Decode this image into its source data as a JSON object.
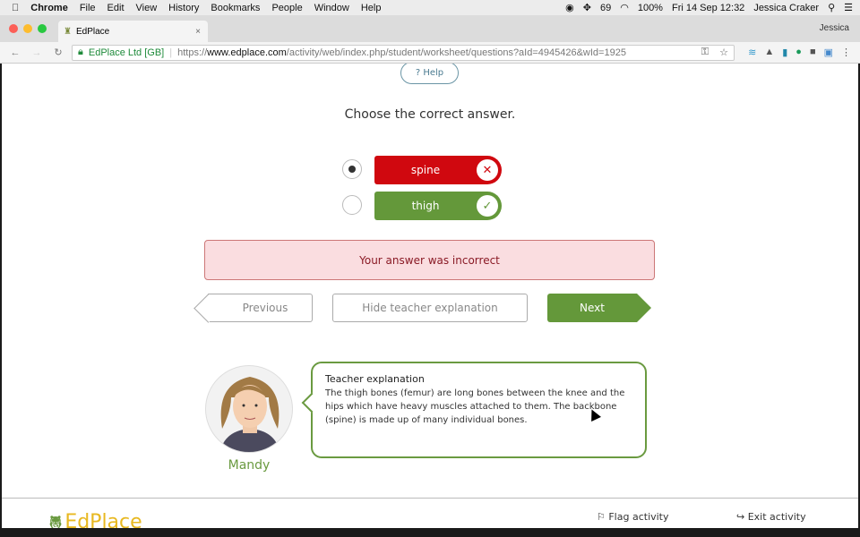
{
  "menubar": {
    "app": "Chrome",
    "items": [
      "File",
      "Edit",
      "View",
      "History",
      "Bookmarks",
      "People",
      "Window",
      "Help"
    ],
    "status": {
      "badge_count": "69",
      "battery": "100%",
      "datetime": "Fri 14 Sep 12:32",
      "user": "Jessica Craker"
    }
  },
  "browser": {
    "tab_title": "EdPlace",
    "profile": "Jessica",
    "security_label": "EdPlace Ltd [GB]",
    "url_prefix": "https://",
    "url_domain": "www.edplace.com",
    "url_path": "/activity/web/index.php/student/worksheet/questions?aId=4945426&wId=1925"
  },
  "question": {
    "help_label": "? Help",
    "prompt": "Choose the correct answer.",
    "options": [
      {
        "label": "spine",
        "selected": true,
        "status": "incorrect",
        "color": "#d0080f"
      },
      {
        "label": "thigh",
        "selected": false,
        "status": "correct",
        "color": "#64983a"
      }
    ]
  },
  "feedback": "Your answer was incorrect",
  "buttons": {
    "previous": "Previous",
    "hide_explanation": "Hide teacher explanation",
    "next": "Next"
  },
  "teacher": {
    "name": "Mandy",
    "title": "Teacher explanation",
    "text": "The thigh bones (femur) are long bones between the knee and the hips which have heavy muscles attached to them. The backbone (spine) is made up of many individual bones."
  },
  "footer": {
    "logo": "EdPlace",
    "flag": "Flag activity",
    "exit": "Exit activity"
  }
}
